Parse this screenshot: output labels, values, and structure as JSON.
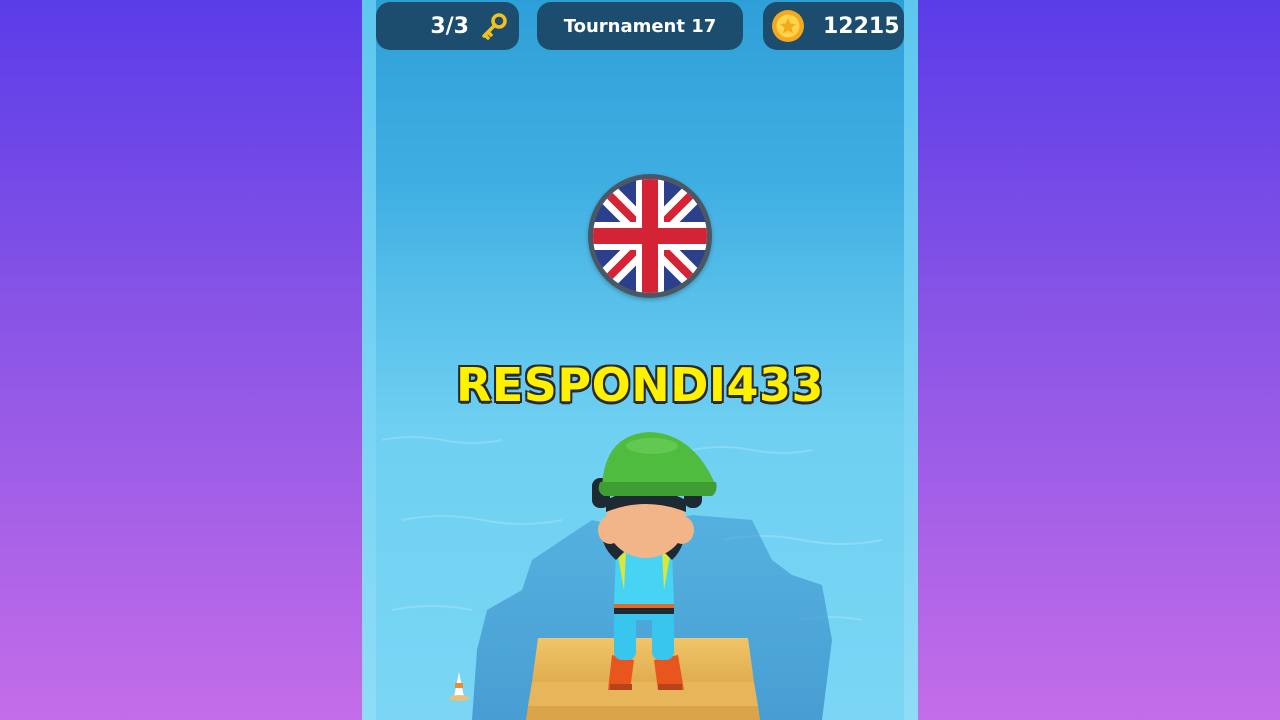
{
  "hud": {
    "keys": "3/3",
    "key_icon": "key-icon",
    "tournament": "Tournament 17",
    "coins": "12215",
    "coin_icon": "coin-icon"
  },
  "player": {
    "flag": "united-kingdom-flag",
    "name": "RESPONDI433"
  },
  "colors": {
    "name_text": "#fff200",
    "hud_bg": "#1d4d6e",
    "water": "#58c0ea"
  }
}
